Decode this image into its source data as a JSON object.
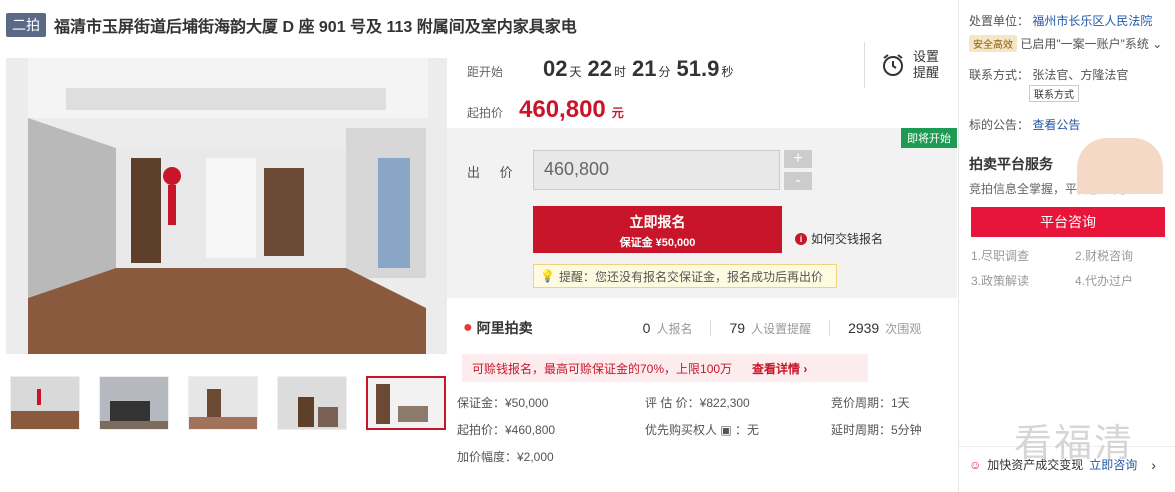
{
  "listing": {
    "badge": "二拍",
    "title": "福清市玉屏街道后埔街海韵大厦 D 座 901 号及 113 附属间及室内家具家电"
  },
  "countdown": {
    "label": "距开始",
    "days": "02",
    "days_unit": "天",
    "hours": "22",
    "hours_unit": "时",
    "minutes": "21",
    "minutes_unit": "分",
    "seconds": "51.9",
    "seconds_unit": "秒"
  },
  "start_price": {
    "label": "起拍价",
    "value": "460,800",
    "unit": "元"
  },
  "reminder": {
    "line1": "设置",
    "line2": "提醒"
  },
  "bid": {
    "status_tag": "即将开始",
    "label": "出 价",
    "value": "460,800",
    "plus": "+",
    "minus": "-",
    "signup_label": "立即报名",
    "deposit_label": "保证金 ¥50,000",
    "howto_label": "如何交钱报名",
    "tip": "提醒：您还没有报名交保证金，报名成功后再出价"
  },
  "stats": {
    "brand": "阿里拍卖",
    "signups": "0",
    "signups_label": "人报名",
    "reminders": "79",
    "reminders_label": "人设置提醒",
    "views": "2939",
    "views_label": "次围观"
  },
  "promo": {
    "text": "可赊钱报名，最高可赊保证金的70%，上限100万",
    "link": "查看详情 ›"
  },
  "details": [
    "保证金：¥50,000",
    "评 估 价：¥822,300",
    "竞价周期：1天",
    "起拍价：¥460,800",
    "优先购买权人 ▣ ：无",
    "延时周期：5分钟",
    "加价幅度：¥2,000"
  ],
  "sidebar": {
    "org_label": "处置单位：",
    "org_name": "福州市长乐区人民法院",
    "safe_tag": "安全高效",
    "account_text": "已启用\"一案一账户\"系统 ⌄",
    "contact_label": "联系方式：",
    "contact_names": "张法官、方隆法官",
    "contact_btn": "联系方式",
    "notice_label": "标的公告：",
    "notice_link": "查看公告",
    "svc_title": "拍卖平台服务",
    "svc_sub": "竞拍信息全掌握，平台服务更放心",
    "consult_btn": "平台咨询",
    "services": [
      "1.尽职调查",
      "2.财税咨询",
      "3.政策解读",
      "4.代办过户"
    ],
    "footer_text": "加快资产成交变现",
    "footer_link": "立即咨询",
    "footer_arrow": "›"
  },
  "watermark": "看福清",
  "colors": {
    "accent": "#c9152a",
    "soon": "#1e9b52",
    "link": "#2457a6"
  }
}
